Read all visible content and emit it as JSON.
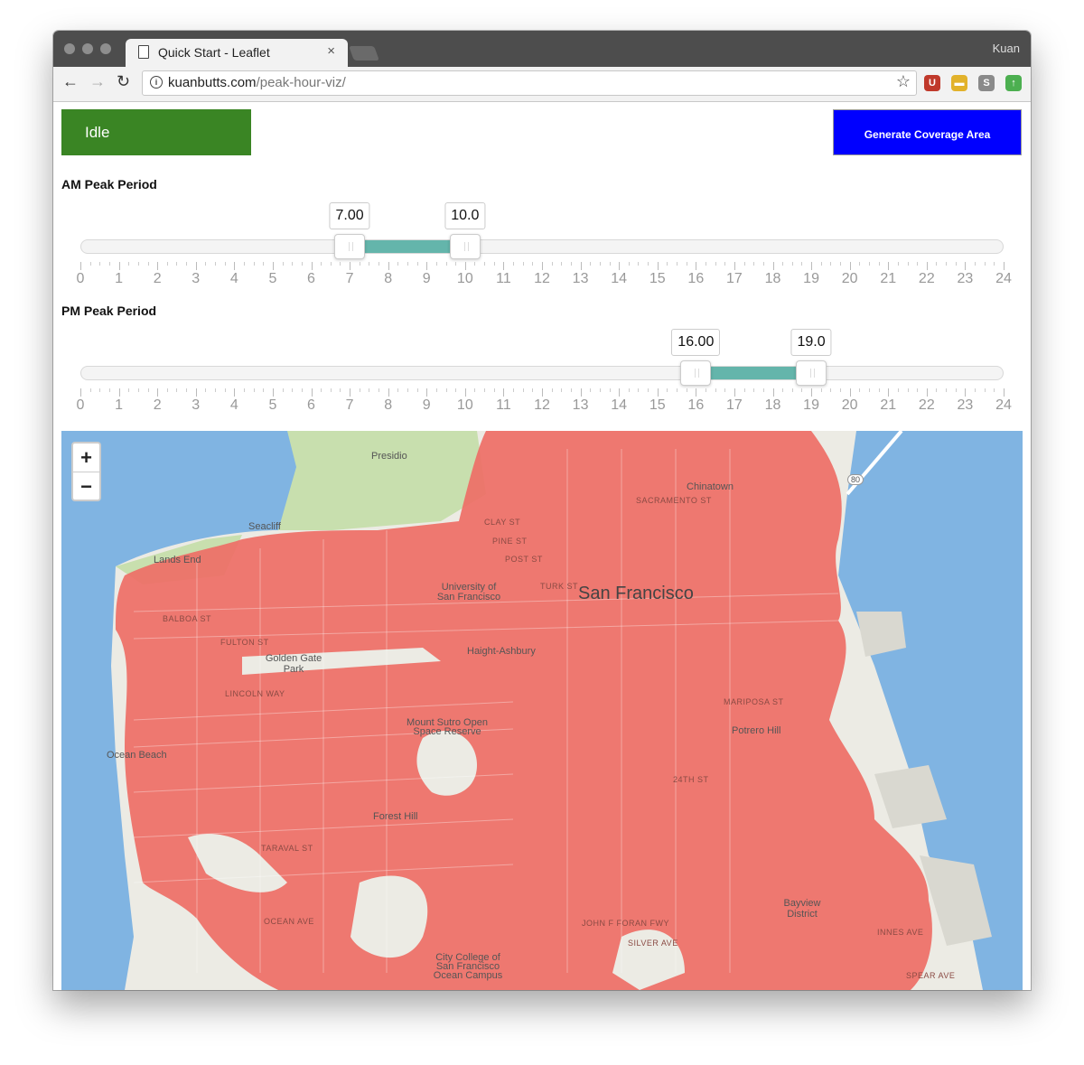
{
  "browser": {
    "tab_title": "Quick Start - Leaflet",
    "tab_close": "×",
    "profile_name": "Kuan",
    "url_host": "kuanbutts.com",
    "url_path": "/peak-hour-viz/",
    "back_icon": "←",
    "forward_icon": "→",
    "reload_icon": "↻",
    "star_icon": "☆",
    "extensions": [
      {
        "name": "ublock-icon",
        "glyph": "U",
        "color": "#c0392b"
      },
      {
        "name": "notes-extension-icon",
        "glyph": "▬",
        "color": "#e2b22b"
      },
      {
        "name": "s-extension-icon",
        "glyph": "S",
        "color": "#8a8a8a"
      },
      {
        "name": "upload-extension-icon",
        "glyph": "↑",
        "color": "#4caf50"
      }
    ]
  },
  "status": {
    "label": "Idle",
    "color": "#3a8524"
  },
  "generate_button": {
    "label": "Generate Coverage Area",
    "color": "#0000ff"
  },
  "am_slider": {
    "label": "AM Peak Period",
    "from": 7,
    "to": 10,
    "from_label": "7.00",
    "to_label": "10.0",
    "min": 0,
    "max": 24
  },
  "pm_slider": {
    "label": "PM Peak Period",
    "from": 16,
    "to": 19,
    "from_label": "16.00",
    "to_label": "19.0",
    "min": 0,
    "max": 24
  },
  "tick_labels": [
    "0",
    "1",
    "2",
    "3",
    "4",
    "5",
    "6",
    "7",
    "8",
    "9",
    "10",
    "11",
    "12",
    "13",
    "14",
    "15",
    "16",
    "17",
    "18",
    "19",
    "20",
    "21",
    "22",
    "23",
    "24"
  ],
  "map": {
    "zoom_in": "+",
    "zoom_out": "−",
    "coverage_color": "#ee6e66",
    "water_color": "#80b4e2",
    "city_label": "San Francisco",
    "place_labels": [
      "Presidio",
      "Chinatown",
      "Seacliff",
      "Lands End",
      "University of San Francisco",
      "Golden Gate Park",
      "Haight-Ashbury",
      "Mount Sutro Open Space Reserve",
      "Potrero Hill",
      "Ocean Beach",
      "Forest Hill",
      "Bayview District",
      "City College of San Francisco Ocean Campus"
    ],
    "street_labels": [
      "CLAY ST",
      "PINE ST",
      "POST ST",
      "SACRAMENTO ST",
      "BALBOA ST",
      "FULTON ST",
      "LINCOLN WAY",
      "TURK ST",
      "MARIPOSA ST",
      "24TH ST",
      "TARAVAL ST",
      "OCEAN AVE",
      "JOHN F FORAN FWY",
      "SILVER AVE",
      "INNES AVE",
      "SPEAR AVE"
    ],
    "highway_shield": "80"
  }
}
